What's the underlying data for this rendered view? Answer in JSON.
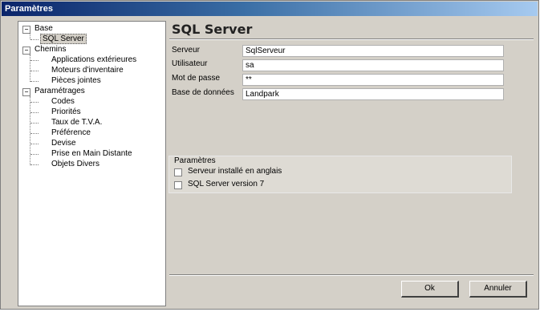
{
  "window": {
    "title": "Paramètres"
  },
  "tree": {
    "base": {
      "label": "Base",
      "expander": "−",
      "children": [
        "SQL Server"
      ]
    },
    "chemins": {
      "label": "Chemins",
      "expander": "−",
      "children": [
        "Applications extérieures",
        "Moteurs d'inventaire",
        "Pièces jointes"
      ]
    },
    "parametrages": {
      "label": "Paramétrages",
      "expander": "−",
      "children": [
        "Codes",
        "Priorités",
        "Taux de T.V.A.",
        "Préférence",
        "Devise",
        "Prise en Main Distante",
        "Objets Divers"
      ]
    },
    "selected": "SQL Server"
  },
  "panel": {
    "title": "SQL Server",
    "fields": [
      {
        "label": "Serveur",
        "value": "SqlServeur"
      },
      {
        "label": "Utilisateur",
        "value": "sa"
      },
      {
        "label": "Mot de passe",
        "value": "**"
      },
      {
        "label": "Base de données",
        "value": "Landpark"
      }
    ],
    "params_legend": "Paramètres",
    "checkboxes": [
      {
        "label": "Serveur installé en anglais",
        "checked": false
      },
      {
        "label": "SQL Server version 7",
        "checked": false
      }
    ]
  },
  "buttons": {
    "ok": "Ok",
    "cancel": "Annuler"
  }
}
